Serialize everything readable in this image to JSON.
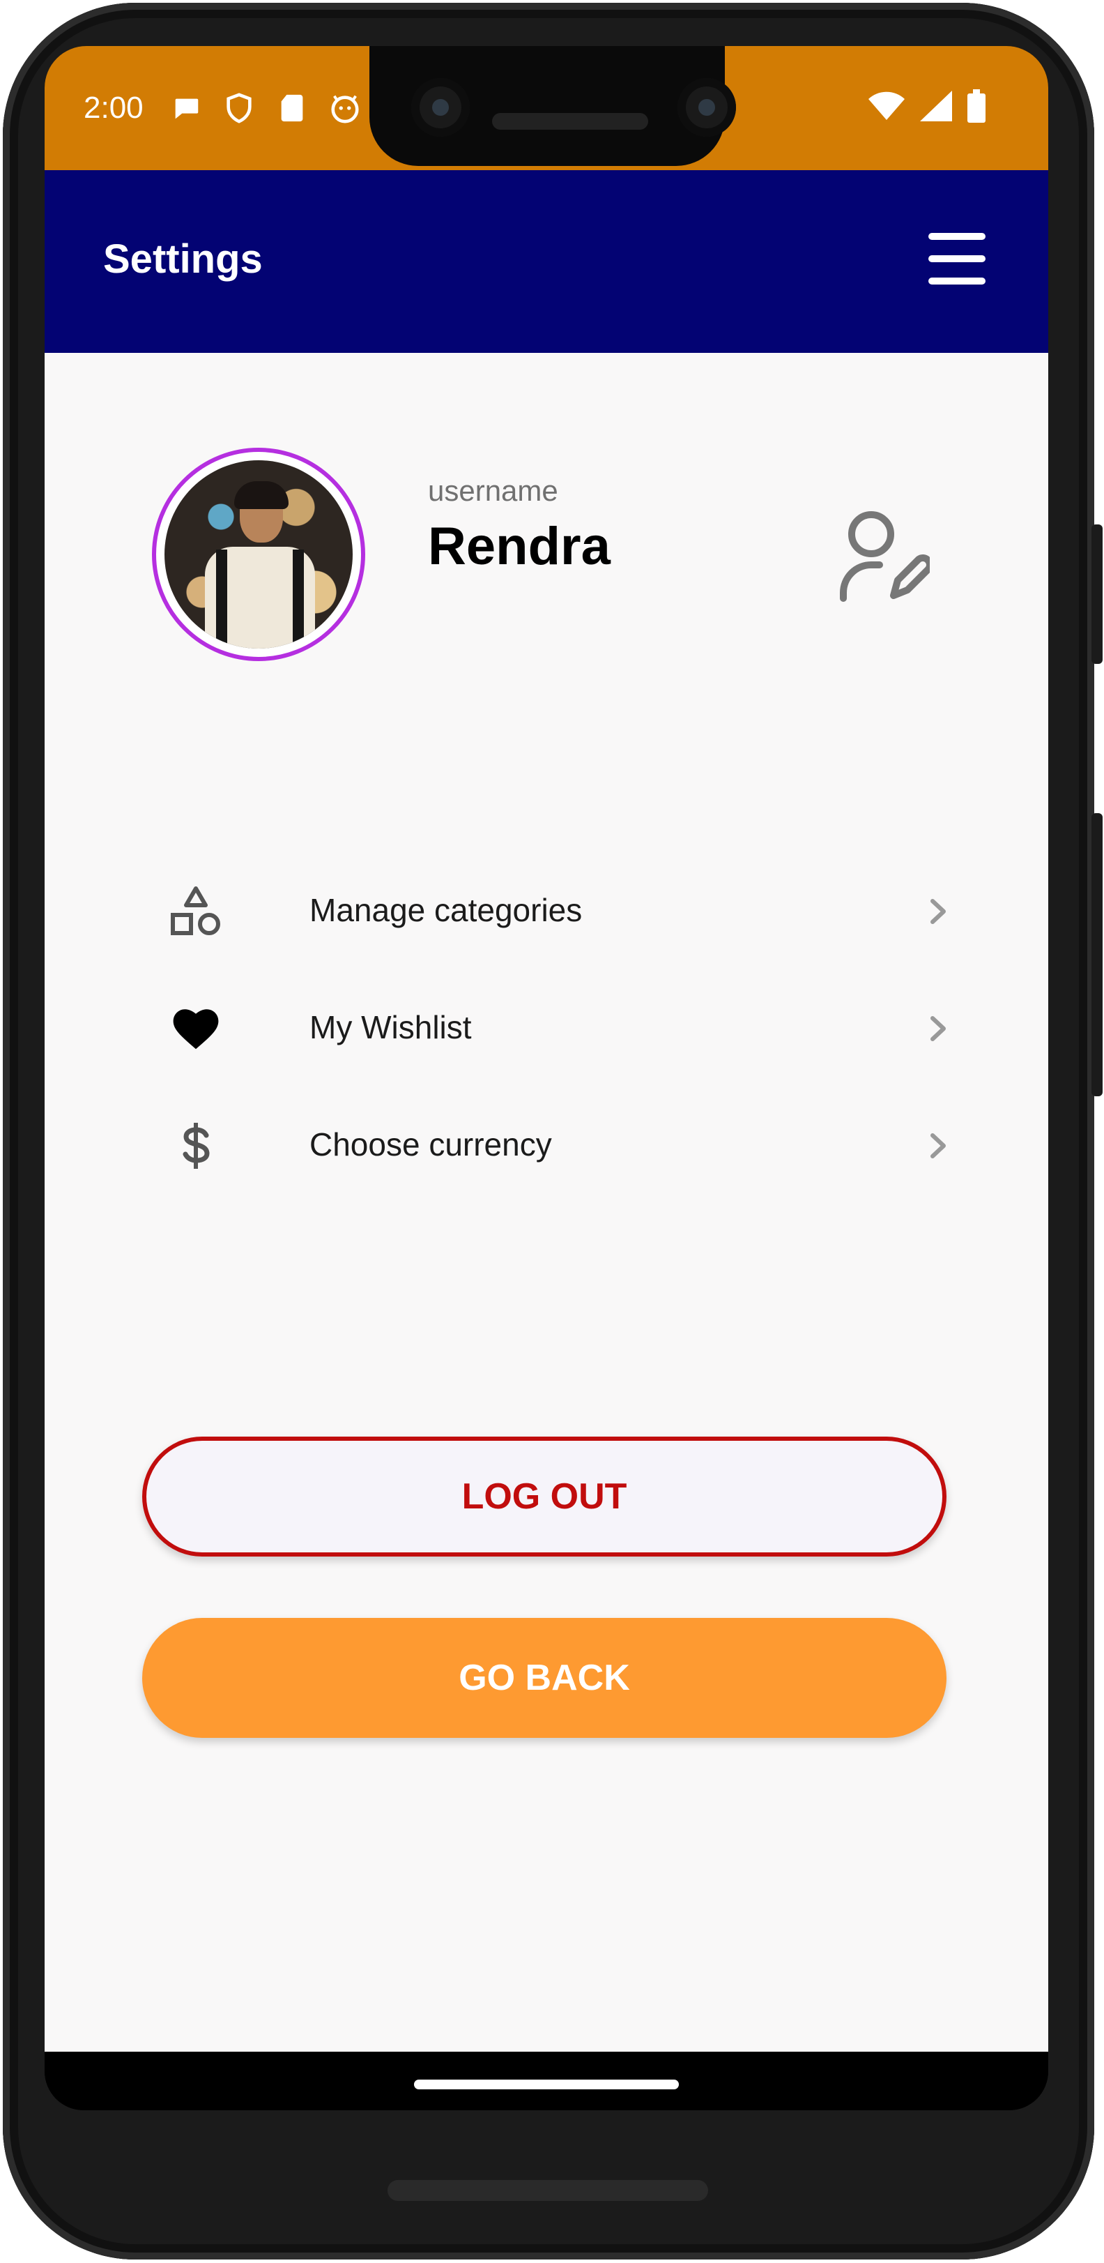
{
  "status_bar": {
    "time": "2:00",
    "left_icons": [
      "message-icon",
      "shield-icon",
      "sd-card-icon",
      "android-debug-icon"
    ],
    "right_icons": [
      "wifi-icon",
      "signal-icon",
      "battery-icon"
    ],
    "background": "#d27c04"
  },
  "app_bar": {
    "title": "Settings",
    "menu_icon": "hamburger-menu-icon",
    "background": "#030373"
  },
  "profile": {
    "username_label": "username",
    "username": "Rendra",
    "avatar_ring_color": "#b52fe0",
    "edit_icon": "edit-user-icon"
  },
  "menu": {
    "items": [
      {
        "label": "Manage categories",
        "icon": "shapes-icon"
      },
      {
        "label": "My Wishlist",
        "icon": "heart-icon"
      },
      {
        "label": "Choose currency",
        "icon": "dollar-icon"
      }
    ]
  },
  "buttons": {
    "logout": "LOG OUT",
    "go_back": "GO BACK",
    "logout_color": "#c10d0d",
    "go_back_color": "#fe9a31"
  }
}
